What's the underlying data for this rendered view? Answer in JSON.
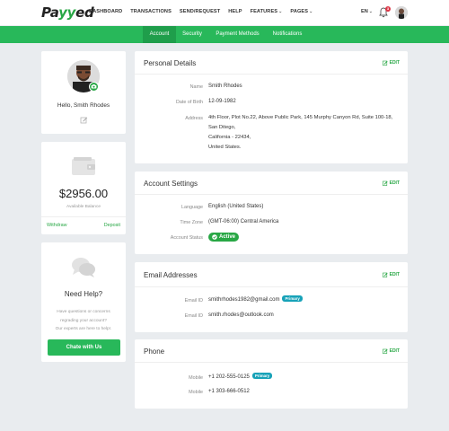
{
  "brand": {
    "logo_pre": "Pa",
    "logo_y": "yy",
    "logo_post": "ed"
  },
  "nav": {
    "items": [
      "DASHBOARD",
      "TRANSACTIONS",
      "SEND/REQUEST",
      "HELP",
      "FEATURES",
      "PAGES"
    ],
    "language": "EN",
    "notification_count": "3"
  },
  "tabs": [
    "Account",
    "Security",
    "Payment Methods",
    "Notifications"
  ],
  "profile": {
    "greeting": "Hello, Smith Rhodes"
  },
  "balance": {
    "amount": "$2956.00",
    "label": "Available Balance",
    "withdraw": "Withdraw",
    "deposit": "Deposit"
  },
  "help": {
    "title": "Need Help?",
    "text": [
      "Have questions or concerns",
      "regrading your account?",
      "Our experts are here to help!."
    ],
    "button": "Chate with Us"
  },
  "personal": {
    "title": "Personal Details",
    "edit": "EDIT",
    "name_label": "Name",
    "name": "Smith Rhodes",
    "dob_label": "Date of Birth",
    "dob": "12-09-1982",
    "address_label": "Address",
    "address": [
      "4th Floor, Plot No.22, Above Public Park, 145 Murphy Canyon Rd, Suite 100-18,",
      "San Ditego,",
      "California - 22434,",
      "United States."
    ]
  },
  "settings": {
    "title": "Account Settings",
    "edit": "EDIT",
    "language_label": "Language",
    "language": "English (United States)",
    "timezone_label": "Time Zone",
    "timezone": "(GMT-06:00) Central America",
    "status_label": "Account Status",
    "status": "Active"
  },
  "email": {
    "title": "Email Addresses",
    "edit": "EDIT",
    "label1": "Email ID",
    "email1": "smithrhodes1982@gmail.com",
    "primary": "Primary",
    "label2": "Email ID",
    "email2": "smith.rhodes@outlook.com"
  },
  "phone": {
    "title": "Phone",
    "edit": "EDIT",
    "label1": "Mobile",
    "phone1": "+1 202-555-0125",
    "primary": "Primary",
    "label2": "Mobile",
    "phone2": "+1 303-666-0512"
  },
  "colors": {
    "accent": "#28b85a",
    "accent_dark": "#1f9e4b",
    "badge_blue": "#17a2b8",
    "alert_red": "#dc3545"
  }
}
